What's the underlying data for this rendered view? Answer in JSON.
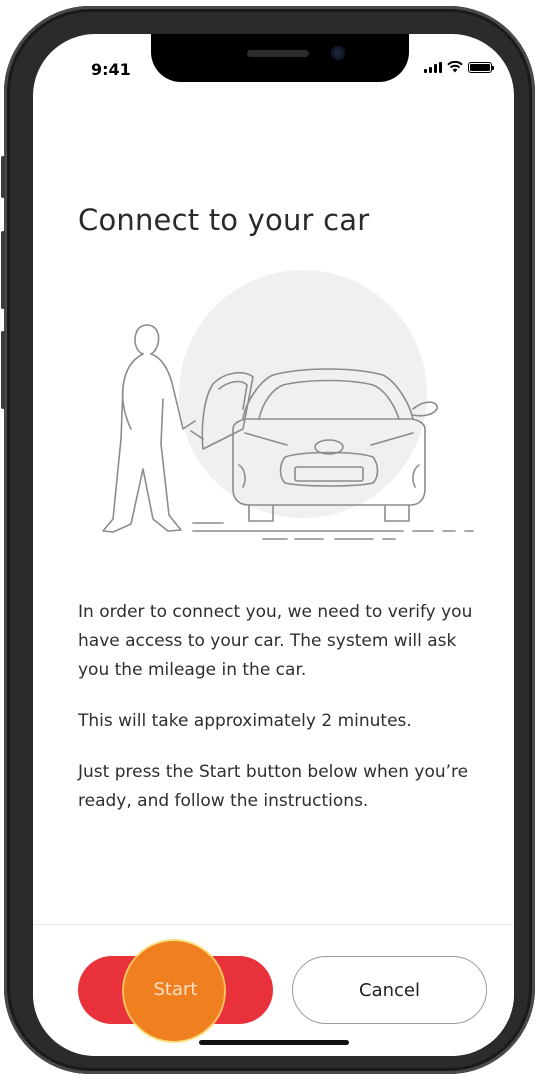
{
  "status_bar": {
    "time": "9:41",
    "signal_icon": "cellular-signal-icon",
    "wifi_icon": "wifi-icon",
    "battery_icon": "battery-icon"
  },
  "screen": {
    "title": "Connect to your car",
    "illustration": "person-opening-car-door-illustration",
    "paragraphs": [
      "In order to connect you, we need to verify you have access to your car. The system will ask you the mileage in the car.",
      "This will take approximately 2 minutes.",
      "Just press the Start button below when you’re ready, and follow the instructions."
    ]
  },
  "actions": {
    "start_label": "Start",
    "cancel_label": "Cancel"
  },
  "colors": {
    "primary": "#e8313a",
    "tap_highlight": "#f07f1f",
    "tap_halo": "#f9d965",
    "text": "#2e2e2e",
    "illustration_circle": "#f0f0f0"
  }
}
